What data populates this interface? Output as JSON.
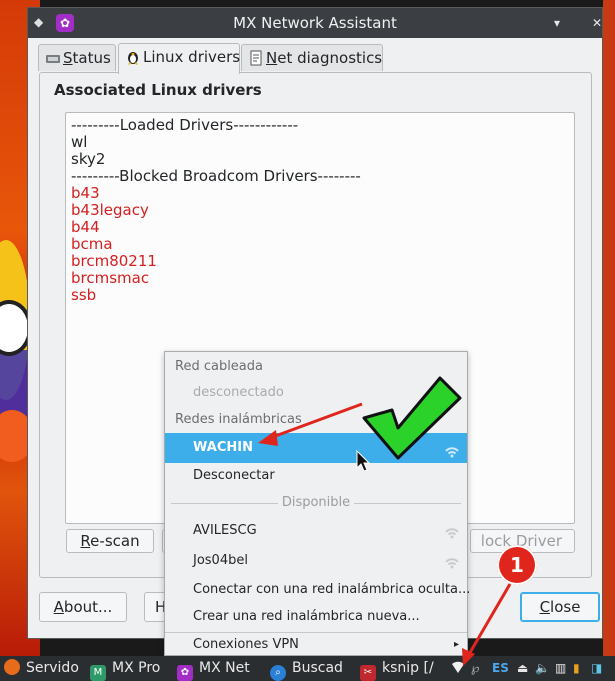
{
  "window": {
    "title": "MX Network Assistant",
    "pin_icon": "pin-icon",
    "app_icon": "gear-icon",
    "minimize_glyph": "▾",
    "maximize_glyph": "▴",
    "close_glyph": "✕"
  },
  "tabs": [
    {
      "label": "Status",
      "access_key": "S",
      "rest": "tatus",
      "active": false
    },
    {
      "label": "Linux drivers",
      "active": true
    },
    {
      "label": "Net diagnostics",
      "access_key": "N",
      "rest": "et diagnostics",
      "active": false
    }
  ],
  "panel": {
    "title": "Associated Linux drivers",
    "lines": [
      {
        "text": "---------Loaded Drivers------------",
        "blocked": false
      },
      {
        "text": "wl",
        "blocked": false
      },
      {
        "text": "sky2",
        "blocked": false
      },
      {
        "text": "---------Blocked Broadcom Drivers--------",
        "blocked": false
      },
      {
        "text": "b43",
        "blocked": true
      },
      {
        "text": "b43legacy",
        "blocked": true
      },
      {
        "text": "b44",
        "blocked": true
      },
      {
        "text": "bcma",
        "blocked": true
      },
      {
        "text": "brcm80211",
        "blocked": true
      },
      {
        "text": "brcmsmac",
        "blocked": true
      },
      {
        "text": "ssb",
        "blocked": true
      }
    ],
    "rescan_label": "Re-scan",
    "block_label": "lock Driver"
  },
  "footer": {
    "about_label": "About...",
    "help_label": "H",
    "close_label": "Close"
  },
  "network_menu": {
    "wired_section": "Red cableada",
    "wired_status": "desconectado",
    "wireless_section": "Redes inalámbricas",
    "connected_network": "WACHIN",
    "disconnect": "Desconectar",
    "available_separator": "Disponible",
    "networks": [
      "AVILESCG",
      "Jos04bel"
    ],
    "connect_hidden": "Conectar con una red inalámbrica oculta...",
    "create_network": "Crear una red inalámbrica nueva...",
    "vpn": "Conexiones VPN",
    "submenu_glyph": "▸"
  },
  "taskbar": {
    "items": [
      {
        "label": "Servido",
        "icon": "firefox-icon",
        "color": "#e86a1b"
      },
      {
        "label": "MX Pro",
        "icon": "mx-icon",
        "color": "#2f9a69"
      },
      {
        "label": "MX Net",
        "icon": "gear-icon",
        "color": "#a32ec7"
      },
      {
        "label": "Buscad",
        "icon": "search-icon",
        "color": "#2a7fd6"
      },
      {
        "label": "ksnip [/",
        "icon": "ksnip-icon",
        "color": "#c1282e"
      }
    ],
    "language": "ES"
  },
  "annotation": {
    "badge_number": "1"
  },
  "colors": {
    "accent": "#3daee9",
    "blocked_text": "#d42020",
    "annotation_red": "#e0261c",
    "checkmark_green": "#2bd22a"
  }
}
